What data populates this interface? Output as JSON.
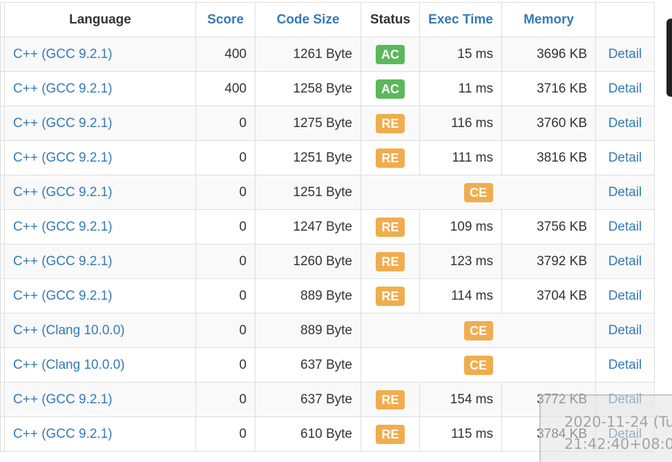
{
  "table": {
    "headers": {
      "language": "Language",
      "score": "Score",
      "code_size": "Code Size",
      "status": "Status",
      "exec_time": "Exec Time",
      "memory": "Memory"
    },
    "rows": [
      {
        "language": "C++ (GCC 9.2.1)",
        "score": "400",
        "code_size": "1261 Byte",
        "status": "AC",
        "exec_time": "15 ms",
        "memory": "3696 KB",
        "detail": "Detail"
      },
      {
        "language": "C++ (GCC 9.2.1)",
        "score": "400",
        "code_size": "1258 Byte",
        "status": "AC",
        "exec_time": "11 ms",
        "memory": "3716 KB",
        "detail": "Detail"
      },
      {
        "language": "C++ (GCC 9.2.1)",
        "score": "0",
        "code_size": "1275 Byte",
        "status": "RE",
        "exec_time": "116 ms",
        "memory": "3760 KB",
        "detail": "Detail"
      },
      {
        "language": "C++ (GCC 9.2.1)",
        "score": "0",
        "code_size": "1251 Byte",
        "status": "RE",
        "exec_time": "111 ms",
        "memory": "3816 KB",
        "detail": "Detail"
      },
      {
        "language": "C++ (GCC 9.2.1)",
        "score": "0",
        "code_size": "1251 Byte",
        "status": "CE",
        "exec_time": "",
        "memory": "",
        "detail": "Detail"
      },
      {
        "language": "C++ (GCC 9.2.1)",
        "score": "0",
        "code_size": "1247 Byte",
        "status": "RE",
        "exec_time": "109 ms",
        "memory": "3756 KB",
        "detail": "Detail"
      },
      {
        "language": "C++ (GCC 9.2.1)",
        "score": "0",
        "code_size": "1260 Byte",
        "status": "RE",
        "exec_time": "123 ms",
        "memory": "3792 KB",
        "detail": "Detail"
      },
      {
        "language": "C++ (GCC 9.2.1)",
        "score": "0",
        "code_size": "889 Byte",
        "status": "RE",
        "exec_time": "114 ms",
        "memory": "3704 KB",
        "detail": "Detail"
      },
      {
        "language": "C++ (Clang 10.0.0)",
        "score": "0",
        "code_size": "889 Byte",
        "status": "CE",
        "exec_time": "",
        "memory": "",
        "detail": "Detail"
      },
      {
        "language": "C++ (Clang 10.0.0)",
        "score": "0",
        "code_size": "637 Byte",
        "status": "CE",
        "exec_time": "",
        "memory": "",
        "detail": "Detail"
      },
      {
        "language": "C++ (GCC 9.2.1)",
        "score": "0",
        "code_size": "637 Byte",
        "status": "RE",
        "exec_time": "154 ms",
        "memory": "3772 KB",
        "detail": "Detail"
      },
      {
        "language": "C++ (GCC 9.2.1)",
        "score": "0",
        "code_size": "610 Byte",
        "status": "RE",
        "exec_time": "115 ms",
        "memory": "3784 KB",
        "detail": "Detail"
      }
    ]
  },
  "colors": {
    "link": "#337ab7",
    "ac": "#5cb85c",
    "re_ce": "#f0ad4e"
  },
  "overlay": {
    "line1": "2020-11-24 (Tu",
    "line2": "21:42:40+08:0"
  }
}
